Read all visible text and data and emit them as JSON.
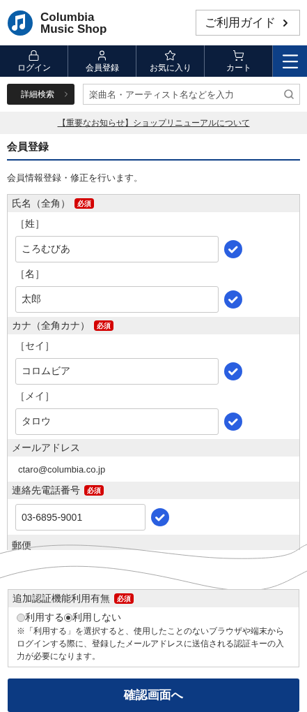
{
  "header": {
    "logo_line1": "Columbia",
    "logo_line2": "Music Shop",
    "guide_button": "ご利用ガイド"
  },
  "nav": [
    {
      "kind": "lock",
      "label": "ログイン"
    },
    {
      "kind": "user",
      "label": "会員登録"
    },
    {
      "kind": "star",
      "label": "お気に入り"
    },
    {
      "kind": "cart",
      "label": "カート"
    }
  ],
  "search": {
    "advanced_button": "詳細検索",
    "placeholder": "楽曲名・アーティスト名などを入力"
  },
  "notice": "【重要なお知らせ】ショップリニューアルについて",
  "page_title": "会員登録",
  "intro": "会員情報登録・修正を行います。",
  "form": [
    {
      "kind": "fields",
      "label": "氏名（全角）",
      "badge": "必須",
      "fields": [
        {
          "sublabel": "［姓］",
          "value": "ころむびあ",
          "valid": true,
          "wide": true
        },
        {
          "sublabel": "［名］",
          "value": "太郎",
          "valid": true,
          "wide": true
        }
      ]
    },
    {
      "kind": "fields",
      "label": "カナ（全角カナ）",
      "badge": "必須",
      "fields": [
        {
          "sublabel": "［セイ］",
          "value": "コロムビア",
          "valid": true,
          "wide": true
        },
        {
          "sublabel": "［メイ］",
          "value": "タロウ",
          "valid": true,
          "wide": true
        }
      ]
    },
    {
      "kind": "text",
      "label": "メールアドレス",
      "value": "ctaro@columbia.co.jp"
    },
    {
      "kind": "fields",
      "label": "連絡先電話番号",
      "badge": "必須",
      "fields": [
        {
          "value": "03-6895-9001",
          "valid": true,
          "wide": false
        }
      ]
    },
    {
      "kind": "cut",
      "label": "郵便"
    }
  ],
  "auth": {
    "label": "追加認証機能利用有無",
    "badge": "必須",
    "options": [
      {
        "label": "利用する",
        "selected": false
      },
      {
        "label": "利用しない",
        "selected": true
      }
    ],
    "note": "※「利用する」を選択すると、使用したことのないブラウザや端末からログインする際に、登録したメールアドレスに送信される認証キーの入力が必要になります。"
  },
  "submit": "確認画面へ"
}
